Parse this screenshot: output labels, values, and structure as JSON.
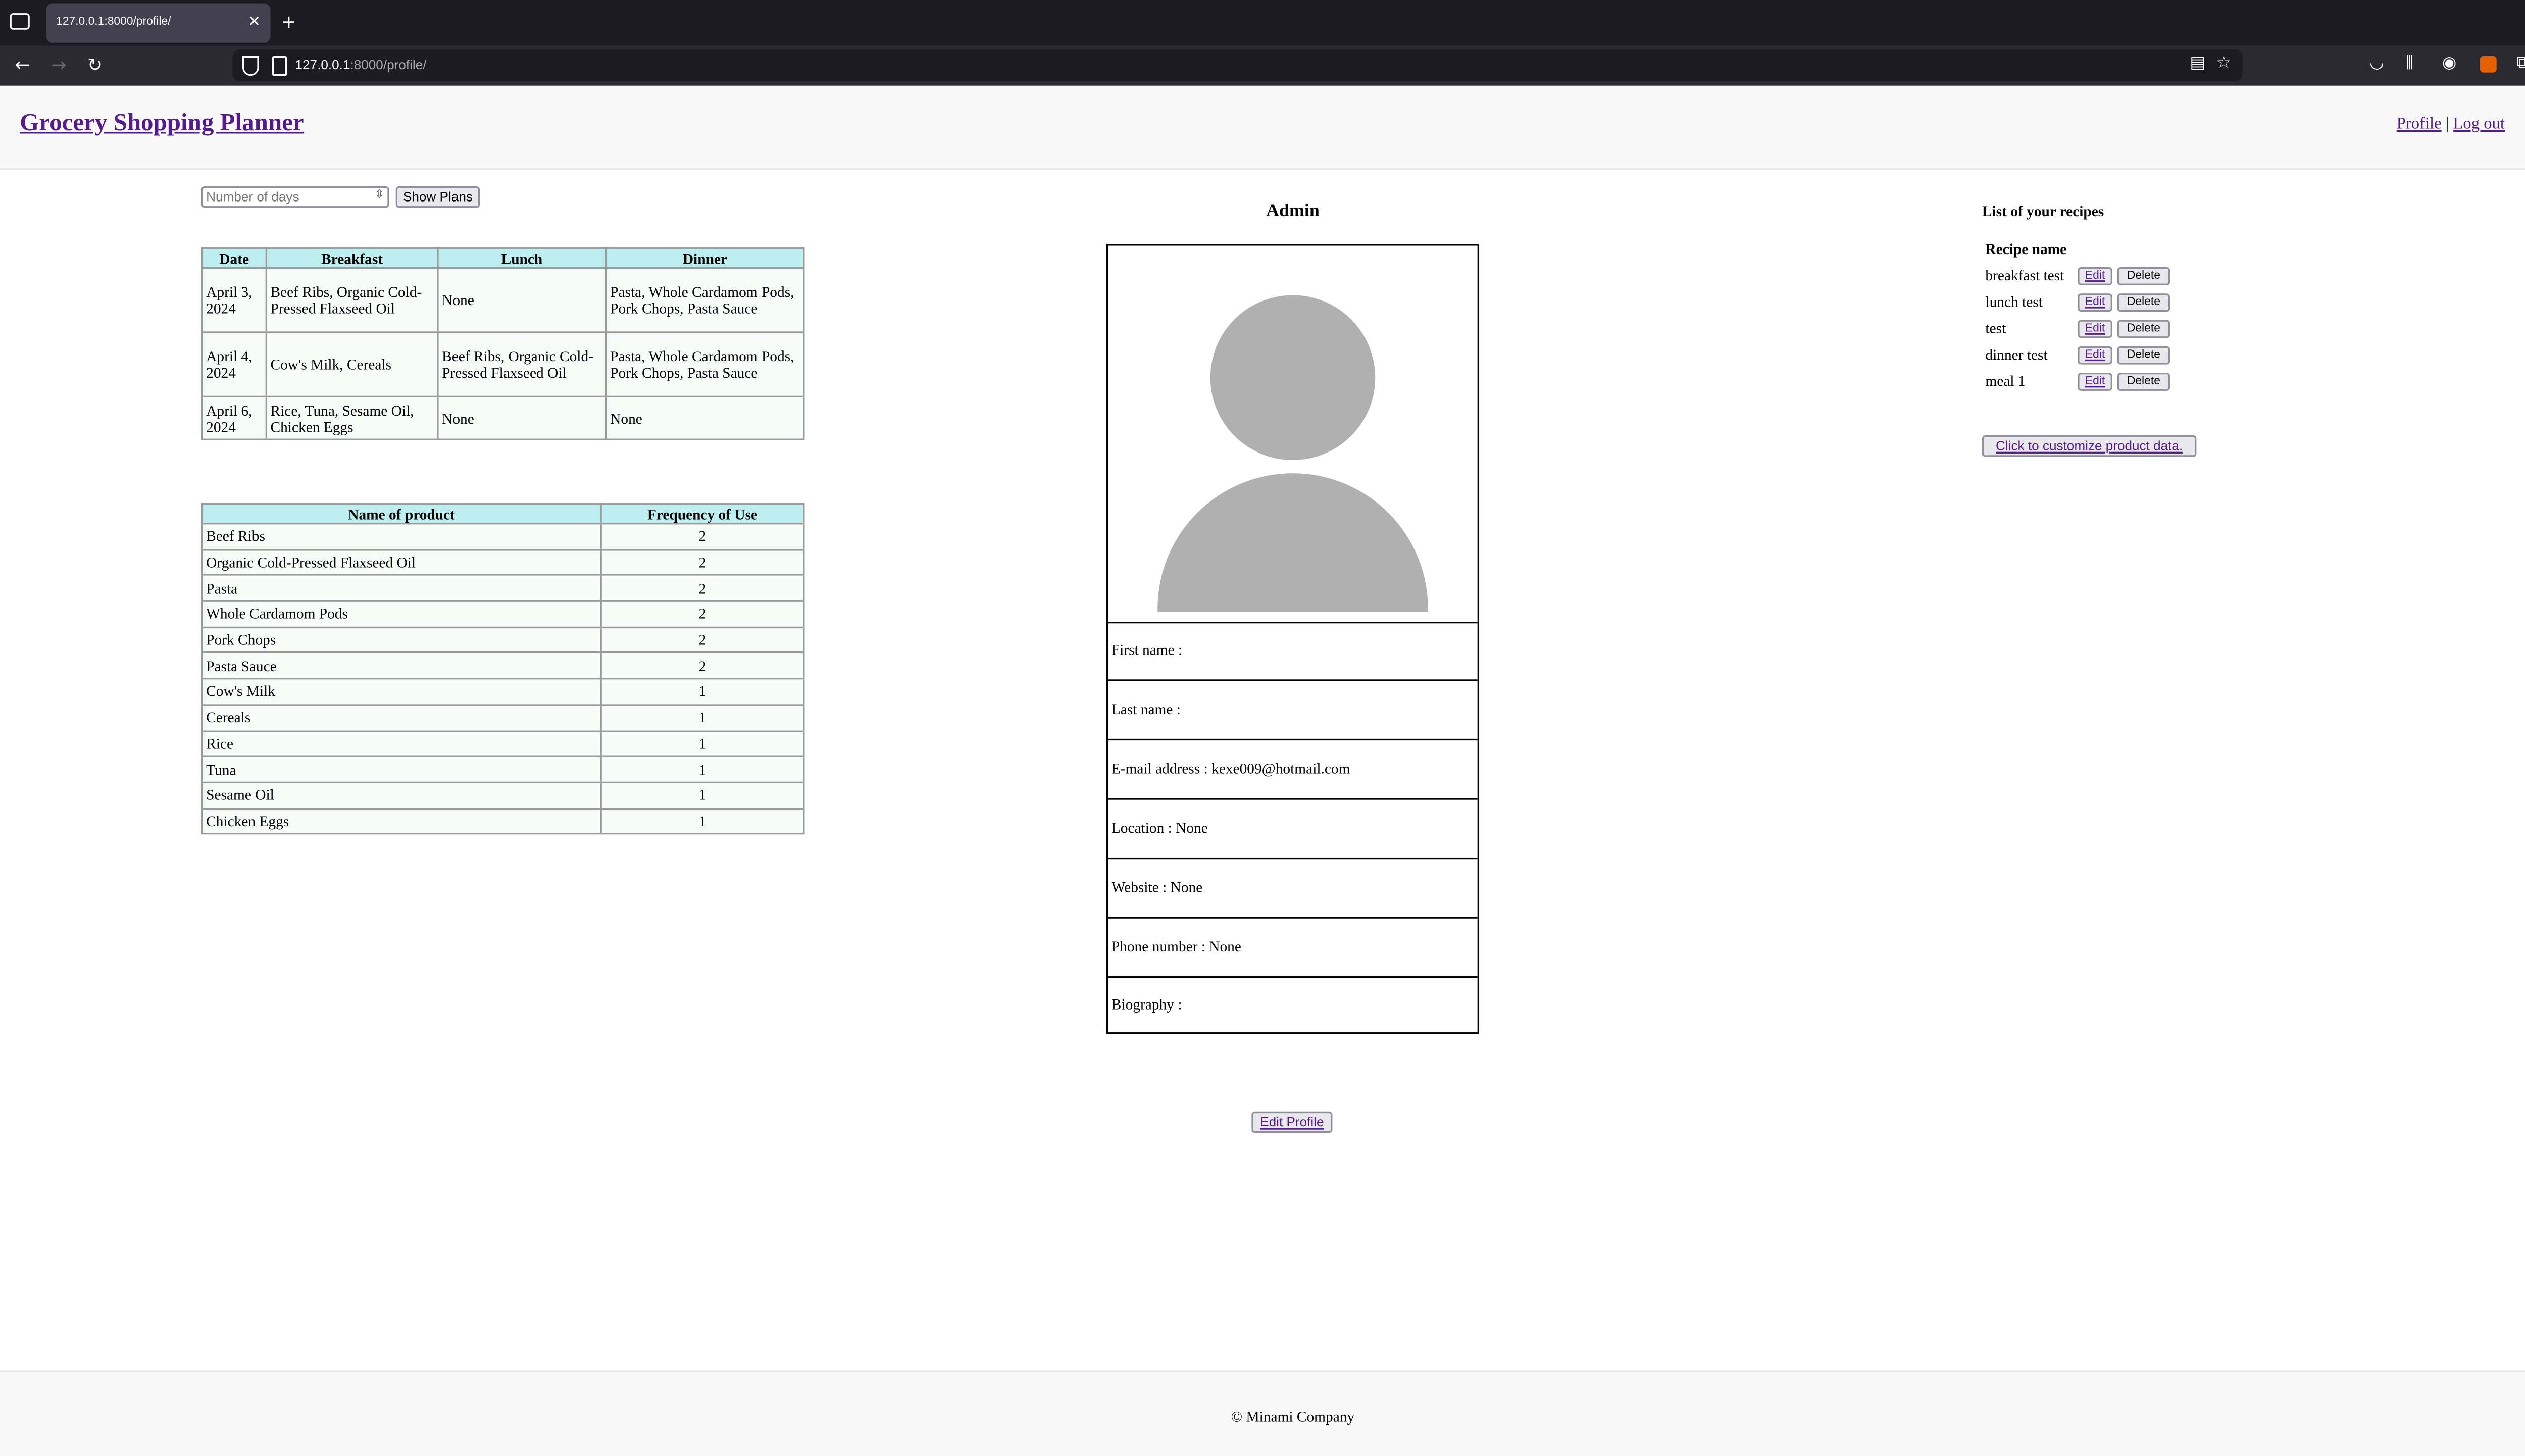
{
  "browser": {
    "tab_title": "127.0.0.1:8000/profile/",
    "url_host": "127.0.0.1",
    "url_rest": ":8000/profile/"
  },
  "header": {
    "title": "Grocery Shopping Planner",
    "profile_link": "Profile",
    "separator": "|",
    "logout_link": "Log out"
  },
  "plans": {
    "days_placeholder": "Number of days",
    "show_button": "Show Plans",
    "columns": [
      "Date",
      "Breakfast",
      "Lunch",
      "Dinner"
    ],
    "rows": [
      [
        "April 3, 2024",
        "Beef Ribs, Organic Cold-Pressed Flaxseed Oil",
        "None",
        "Pasta, Whole Cardamom Pods, Pork Chops, Pasta Sauce"
      ],
      [
        "April 4, 2024",
        "Cow's Milk, Cereals",
        "Beef Ribs, Organic Cold-Pressed Flaxseed Oil",
        "Pasta, Whole Cardamom Pods, Pork Chops, Pasta Sauce"
      ],
      [
        "April 6, 2024",
        "Rice, Tuna, Sesame Oil, Chicken Eggs",
        "None",
        "None"
      ]
    ]
  },
  "products": {
    "columns": [
      "Name of product",
      "Frequency of Use"
    ],
    "rows": [
      [
        "Beef Ribs",
        "2"
      ],
      [
        "Organic Cold-Pressed Flaxseed Oil",
        "2"
      ],
      [
        "Pasta",
        "2"
      ],
      [
        "Whole Cardamom Pods",
        "2"
      ],
      [
        "Pork Chops",
        "2"
      ],
      [
        "Pasta Sauce",
        "2"
      ],
      [
        "Cow's Milk",
        "1"
      ],
      [
        "Cereals",
        "1"
      ],
      [
        "Rice",
        "1"
      ],
      [
        "Tuna",
        "1"
      ],
      [
        "Sesame Oil",
        "1"
      ],
      [
        "Chicken Eggs",
        "1"
      ]
    ]
  },
  "profile": {
    "name": "Admin",
    "fields": [
      "First name :",
      "Last name :",
      "E-mail address : kexe009@hotmail.com",
      "Location : None",
      "Website : None",
      "Phone number : None",
      "Biography :"
    ],
    "edit_button": "Edit Profile"
  },
  "recipes": {
    "title": "List of your recipes",
    "header": "Recipe name",
    "items": [
      "breakfast test",
      "lunch test",
      "test",
      "dinner test",
      "meal 1"
    ],
    "edit_label": "Edit",
    "delete_label": "Delete",
    "customize_button": "Click to customize product data."
  },
  "footer": {
    "text": "© Minami Company"
  }
}
